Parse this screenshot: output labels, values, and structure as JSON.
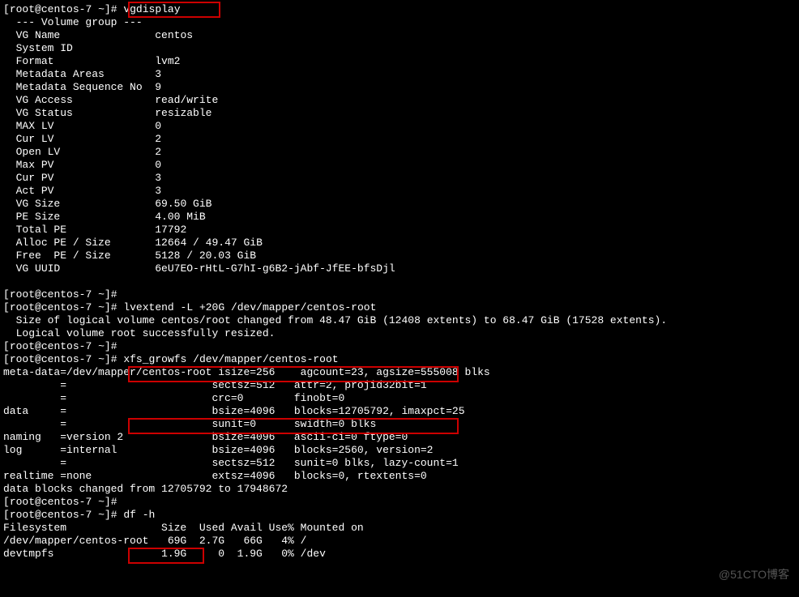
{
  "prompt": {
    "user": "root",
    "host": "centos-7",
    "dir": "~",
    "symbol": "#"
  },
  "cmd": {
    "vgdisplay": "vgdisplay",
    "lvextend": "lvextend -L +20G /dev/mapper/centos-root",
    "xfs": "xfs_growfs /dev/mapper/centos-root",
    "df": "df -h"
  },
  "vgdisplay": {
    "header": "--- Volume group ---",
    "labels": {
      "name": "VG Name",
      "sysid": "System ID",
      "format": "Format",
      "mareas": "Metadata Areas",
      "mseq": "Metadata Sequence No",
      "access": "VG Access",
      "status": "VG Status",
      "maxlv": "MAX LV",
      "curlv": "Cur LV",
      "openlv": "Open LV",
      "maxpv": "Max PV",
      "curpv": "Cur PV",
      "actpv": "Act PV",
      "vgsize": "VG Size",
      "pesize": "PE Size",
      "totalpe": "Total PE",
      "alloc": "Alloc PE / Size",
      "free": "Free  PE / Size",
      "uuid": "VG UUID"
    },
    "values": {
      "name": "centos",
      "sysid": "",
      "format": "lvm2",
      "mareas": "3",
      "mseq": "9",
      "access": "read/write",
      "status": "resizable",
      "maxlv": "0",
      "curlv": "2",
      "openlv": "2",
      "maxpv": "0",
      "curpv": "3",
      "actpv": "3",
      "vgsize": "69.50 GiB",
      "pesize": "4.00 MiB",
      "totalpe": "17792",
      "alloc": "12664 / 49.47 GiB",
      "free": "5128 / 20.03 GiB",
      "uuid": "6eU7EO-rHtL-G7hI-g6B2-jAbf-JfEE-bfsDjl"
    }
  },
  "lvextend_out": {
    "line1": "Size of logical volume centos/root changed from 48.47 GiB (12408 extents) to 68.47 GiB (17528 extents).",
    "line2": "Logical volume root successfully resized."
  },
  "xfs_out": {
    "l1": "meta-data=/dev/mapper/centos-root isize=256    agcount=23, agsize=555008 blks",
    "l2": "         =                       sectsz=512   attr=2, projid32bit=1",
    "l3": "         =                       crc=0        finobt=0",
    "l4": "data     =                       bsize=4096   blocks=12705792, imaxpct=25",
    "l5": "         =                       sunit=0      swidth=0 blks",
    "l6": "naming   =version 2              bsize=4096   ascii-ci=0 ftype=0",
    "l7": "log      =internal               bsize=4096   blocks=2560, version=2",
    "l8": "         =                       sectsz=512   sunit=0 blks, lazy-count=1",
    "l9": "realtime =none                   extsz=4096   blocks=0, rtextents=0",
    "l10": "data blocks changed from 12705792 to 17948672"
  },
  "df": {
    "header": "Filesystem               Size  Used Avail Use% Mounted on",
    "r1": "/dev/mapper/centos-root   69G  2.7G   66G   4% /",
    "r2": "devtmpfs                 1.9G     0  1.9G   0% /dev"
  },
  "watermark": "@51CTO博客"
}
